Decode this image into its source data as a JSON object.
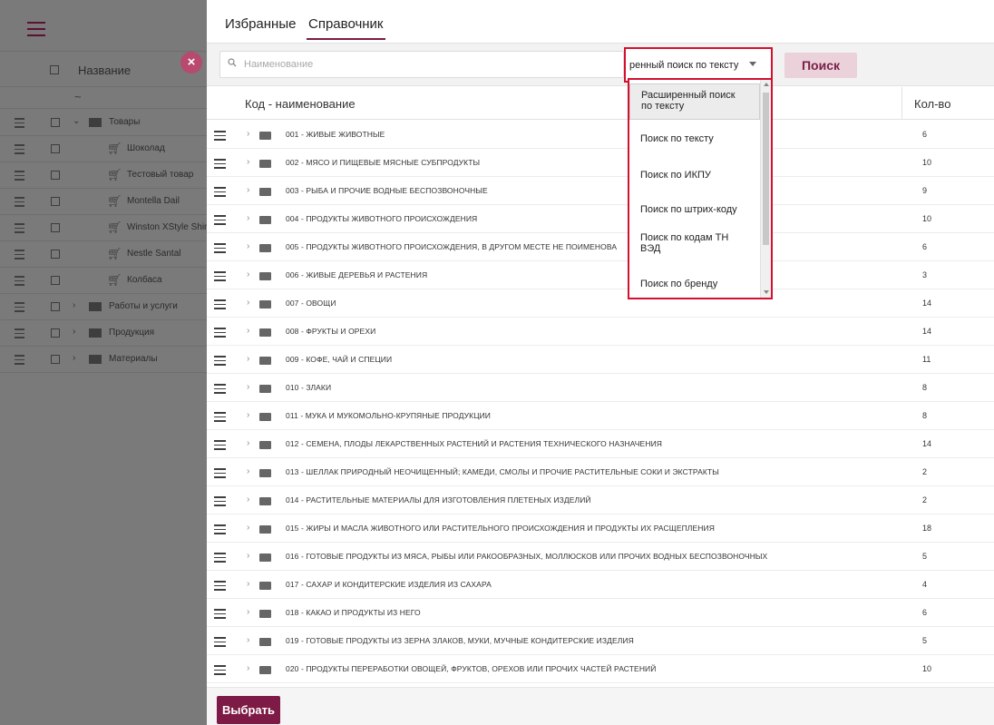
{
  "left": {
    "column_title": "Название",
    "sort_icon": "~",
    "tree": [
      {
        "label": "Товары",
        "type": "folder",
        "expanded": true
      },
      {
        "label": "Шоколад",
        "type": "item"
      },
      {
        "label": "Тестовый товар",
        "type": "item"
      },
      {
        "label": "Montella Dail",
        "type": "item"
      },
      {
        "label": "Winston XStyle Shiny",
        "type": "item"
      },
      {
        "label": "Nestle Santal",
        "type": "item"
      },
      {
        "label": "Колбаса",
        "type": "item"
      },
      {
        "label": "Работы и услуги",
        "type": "folder",
        "expanded": false
      },
      {
        "label": "Продукция",
        "type": "folder",
        "expanded": false
      },
      {
        "label": "Материалы",
        "type": "folder",
        "expanded": false
      }
    ],
    "close_label": "×"
  },
  "tabs": {
    "favorites": "Избранные",
    "directory": "Справочник"
  },
  "search": {
    "placeholder": "Наименование",
    "type_value": "ренный поиск по тексту",
    "button": "Поиск",
    "options": [
      "Расширенный поиск по тексту",
      "Поиск по тексту",
      "Поиск по ИКПУ",
      "Поиск по штрих-коду",
      "Поиск по кодам ТН ВЭД",
      "Поиск по бренду"
    ]
  },
  "table": {
    "col_name": "Код - наименование",
    "col_count": "Кол-во",
    "rows": [
      {
        "name": "001 - ЖИВЫЕ ЖИВОТНЫЕ",
        "count": "6"
      },
      {
        "name": "002 - МЯСО И ПИЩЕВЫЕ МЯСНЫЕ СУБПРОДУКТЫ",
        "count": "10"
      },
      {
        "name": "003 - РЫБА И ПРОЧИЕ ВОДНЫЕ БЕСПОЗВОНОЧНЫЕ",
        "count": "9"
      },
      {
        "name": "004 - ПРОДУКТЫ ЖИВОТНОГО ПРОИСХОЖДЕНИЯ",
        "count": "10"
      },
      {
        "name": "005 - ПРОДУКТЫ ЖИВОТНОГО ПРОИСХОЖДЕНИЯ, В ДРУГОМ МЕСТЕ НЕ ПОИМЕНОВА",
        "count": "6"
      },
      {
        "name": "006 - ЖИВЫЕ ДЕРЕВЬЯ И РАСТЕНИЯ",
        "count": "3"
      },
      {
        "name": "007 - ОВОЩИ",
        "count": "14"
      },
      {
        "name": "008 - ФРУКТЫ И ОРЕХИ",
        "count": "14"
      },
      {
        "name": "009 - КОФЕ, ЧАЙ И СПЕЦИИ",
        "count": "11"
      },
      {
        "name": "010 - ЗЛАКИ",
        "count": "8"
      },
      {
        "name": "011 - МУКА И МУКОМОЛЬНО-КРУПЯНЫЕ ПРОДУКЦИИ",
        "count": "8"
      },
      {
        "name": "012 - СЕМЕНА, ПЛОДЫ ЛЕКАРСТВЕННЫХ РАСТЕНИЙ И РАСТЕНИЯ ТЕХНИЧЕСКОГО НАЗНАЧЕНИЯ",
        "count": "14"
      },
      {
        "name": "013 - ШЕЛЛАК ПРИРОДНЫЙ НЕОЧИЩЕННЫЙ; КАМЕДИ, СМОЛЫ И ПРОЧИЕ РАСТИТЕЛЬНЫЕ СОКИ И ЭКСТРАКТЫ",
        "count": "2"
      },
      {
        "name": "014 - РАСТИТЕЛЬНЫЕ МАТЕРИАЛЫ ДЛЯ ИЗГОТОВЛЕНИЯ ПЛЕТЕНЫХ ИЗДЕЛИЙ",
        "count": "2"
      },
      {
        "name": "015 - ЖИРЫ И МАСЛА ЖИВОТНОГО ИЛИ РАСТИТЕЛЬНОГО ПРОИСХОЖДЕНИЯ И ПРОДУКТЫ ИХ РАСЩЕПЛЕНИЯ",
        "count": "18"
      },
      {
        "name": "016 - ГОТОВЫЕ ПРОДУКТЫ ИЗ МЯСА, РЫБЫ ИЛИ РАКООБРАЗНЫХ, МОЛЛЮСКОВ ИЛИ ПРОЧИХ ВОДНЫХ БЕСПОЗВОНОЧНЫХ",
        "count": "5"
      },
      {
        "name": "017 - САХАР И КОНДИТЕРСКИЕ ИЗДЕЛИЯ ИЗ САХАРА",
        "count": "4"
      },
      {
        "name": "018 - КАКАО И ПРОДУКТЫ ИЗ НЕГО",
        "count": "6"
      },
      {
        "name": "019 - ГОТОВЫЕ ПРОДУКТЫ ИЗ ЗЕРНА ЗЛАКОВ, МУКИ, МУЧНЫЕ КОНДИТЕРСКИЕ ИЗДЕЛИЯ",
        "count": "5"
      },
      {
        "name": "020 - ПРОДУКТЫ ПЕРЕРАБОТКИ ОВОЩЕЙ, ФРУКТОВ, ОРЕХОВ ИЛИ ПРОЧИХ ЧАСТЕЙ РАСТЕНИЙ",
        "count": "10"
      }
    ]
  },
  "footer": {
    "select_button": "Выбрать"
  },
  "colors": {
    "accent": "#7d1a45",
    "highlight_border": "#d4102e",
    "search_button_bg": "#ebd1da"
  }
}
